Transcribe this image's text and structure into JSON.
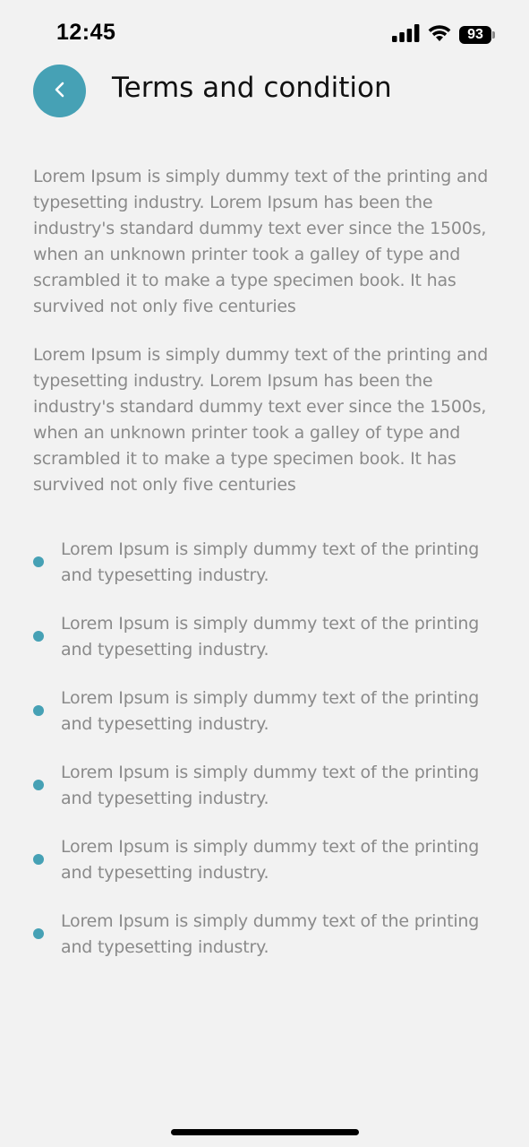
{
  "status_bar": {
    "time": "12:45",
    "battery": "93",
    "icons": [
      "cellular-signal-icon",
      "wifi-icon",
      "battery-icon"
    ]
  },
  "header": {
    "title": "Terms and condition",
    "back_icon": "chevron-left-icon"
  },
  "colors": {
    "accent": "#46a1b5",
    "background": "#f2f2f2",
    "body_text": "#8a8a8a",
    "title_text": "#111111"
  },
  "paragraphs": [
    "Lorem Ipsum is simply dummy text of the printing and typesetting industry. Lorem Ipsum has been the industry's standard dummy text ever since the 1500s, when an unknown printer took a galley of type and scrambled it to make a type specimen book. It has survived not only five centuries",
    "Lorem Ipsum is simply dummy text of the printing and typesetting industry. Lorem Ipsum has been the industry's standard dummy text ever since the 1500s, when an unknown printer took a galley of type and scrambled it to make a type specimen book. It has survived not only five centuries"
  ],
  "bullets": [
    "Lorem Ipsum is simply dummy text of the printing and typesetting industry.",
    "Lorem Ipsum is simply dummy text of the printing and typesetting industry.",
    "Lorem Ipsum is simply dummy text of the printing and typesetting industry.",
    "Lorem Ipsum is simply dummy text of the printing and typesetting industry.",
    "Lorem Ipsum is simply dummy text of the printing and typesetting industry.",
    "Lorem Ipsum is simply dummy text of the printing and typesetting industry."
  ]
}
